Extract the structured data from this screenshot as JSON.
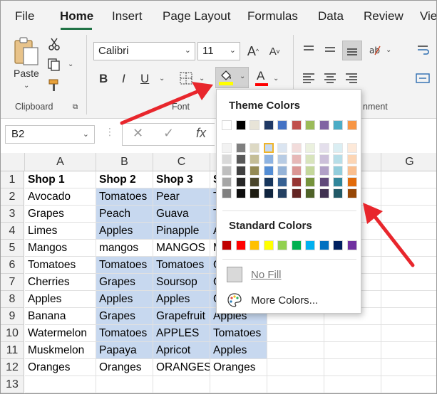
{
  "tabs": [
    "File",
    "Home",
    "Insert",
    "Page Layout",
    "Formulas",
    "Data",
    "Review",
    "Vie"
  ],
  "ribbon": {
    "paste_label": "Paste",
    "clipboard_label": "Clipboard",
    "font_label": "Font",
    "alignment_label_partial": "nment",
    "font_name": "Calibri",
    "font_size": "11",
    "bold": "B",
    "italic": "I",
    "underline": "U"
  },
  "formula_bar": {
    "name_box": "B2",
    "cancel": "✕",
    "enter": "✓",
    "fx": "fx"
  },
  "columns": [
    "A",
    "B",
    "C",
    "",
    "G"
  ],
  "rows": [
    {
      "num": "1",
      "cells": [
        "Shop 1",
        "Shop 2",
        "Shop 3",
        "S"
      ]
    },
    {
      "num": "2",
      "cells": [
        "Avocado",
        "Tomatoes",
        "Pear",
        "T"
      ]
    },
    {
      "num": "3",
      "cells": [
        "Grapes",
        "Peach",
        "Guava",
        "T"
      ]
    },
    {
      "num": "4",
      "cells": [
        "Limes",
        "Apples",
        "Pinapple",
        "A"
      ]
    },
    {
      "num": "5",
      "cells": [
        "Mangos",
        "mangos",
        "MANGOS",
        "M"
      ]
    },
    {
      "num": "6",
      "cells": [
        "Tomatoes",
        "Tomatoes",
        "Tomatoes",
        "G"
      ]
    },
    {
      "num": "7",
      "cells": [
        "Cherries",
        "Grapes",
        "Soursop",
        "C"
      ]
    },
    {
      "num": "8",
      "cells": [
        "Apples",
        "Apples",
        "Apples",
        "G"
      ]
    },
    {
      "num": "9",
      "cells": [
        "Banana",
        "Grapes",
        "Grapefruit",
        "Apples"
      ]
    },
    {
      "num": "10",
      "cells": [
        "Watermelon",
        "Tomatoes",
        "APPLES",
        "Tomatoes"
      ]
    },
    {
      "num": "11",
      "cells": [
        "Muskmelon",
        "Papaya",
        "Apricot",
        "Apples"
      ]
    },
    {
      "num": "12",
      "cells": [
        "Oranges",
        "Oranges",
        "ORANGES",
        "Oranges"
      ]
    },
    {
      "num": "13",
      "cells": [
        "",
        "",
        "",
        ""
      ]
    }
  ],
  "palette": {
    "theme_title": "Theme Colors",
    "standard_title": "Standard Colors",
    "no_fill": "No Fill",
    "more_colors": "More Colors...",
    "theme_top": [
      "#ffffff",
      "#000000",
      "#e7e6e6",
      "#44546a",
      "#4472c4",
      "#ed7d31",
      "#a5a5a5",
      "#ffc000",
      "#5b9bd5",
      "#70ad47"
    ],
    "theme_top_display": [
      "#ffffff",
      "#000000",
      "#e8e4d8",
      "#1f3864",
      "#4472c4",
      "#c0504d",
      "#9bbb59",
      "#8064a2",
      "#4bacc6",
      "#f79646"
    ],
    "theme_shades": [
      [
        "#f2f2f2",
        "#d9d9d9",
        "#bfbfbf",
        "#a6a6a6",
        "#808080"
      ],
      [
        "#7f7f7f",
        "#595959",
        "#404040",
        "#262626",
        "#0d0d0d"
      ],
      [
        "#ddd9c4",
        "#c4bd97",
        "#948a54",
        "#4a452a",
        "#1d1b10"
      ],
      [
        "#c6d9f0",
        "#8db3e2",
        "#548dd4",
        "#17365d",
        "#0f243e"
      ],
      [
        "#dbe5f1",
        "#b8cce4",
        "#95b3d7",
        "#366092",
        "#244062"
      ],
      [
        "#f2dcdb",
        "#e6b8b7",
        "#da9694",
        "#963634",
        "#632523"
      ],
      [
        "#ebf1de",
        "#d8e4bc",
        "#c4d79b",
        "#76933c",
        "#4f6228"
      ],
      [
        "#e4dfec",
        "#ccc0da",
        "#b1a0c7",
        "#60497a",
        "#403151"
      ],
      [
        "#daeef3",
        "#b7dee8",
        "#92cddc",
        "#31869b",
        "#215967"
      ],
      [
        "#fde9d9",
        "#fcd5b4",
        "#fabf8f",
        "#e26b0a",
        "#974706"
      ]
    ],
    "standard": [
      "#c00000",
      "#ff0000",
      "#ffc000",
      "#ffff00",
      "#92d050",
      "#00b050",
      "#00b0f0",
      "#0070c0",
      "#002060",
      "#7030a0"
    ]
  },
  "colors": {
    "selection": "#c7d8ef",
    "accent_green": "#217346",
    "highlight_yellow": "#ffff00",
    "font_red": "#ff0000",
    "arrow_red": "#e8262c"
  }
}
